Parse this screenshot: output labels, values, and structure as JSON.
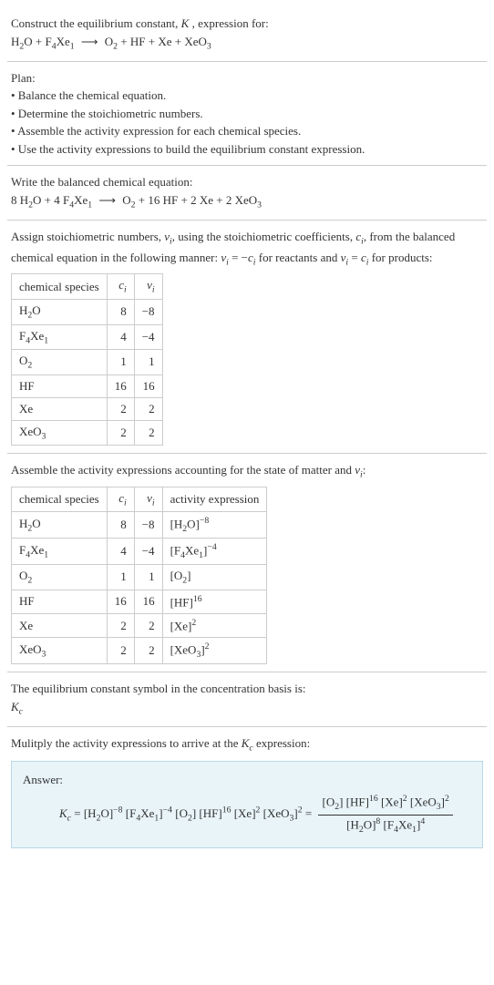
{
  "section1": {
    "l1": "Construct the equilibrium constant, K, expression for:",
    "l2_a": "H",
    "l2_b": "2",
    "l2_c": "O + F",
    "l2_d": "4",
    "l2_e": "Xe",
    "l2_f": "1",
    "l2_arrow": "⟶",
    "l2_g": "O",
    "l2_h": "2",
    "l2_i": " + HF + Xe + XeO",
    "l2_j": "3"
  },
  "section2": {
    "title": "Plan:",
    "b1": "• Balance the chemical equation.",
    "b2": "• Determine the stoichiometric numbers.",
    "b3": "• Assemble the activity expression for each chemical species.",
    "b4": "• Use the activity expressions to build the equilibrium constant expression."
  },
  "section3": {
    "l1": "Write the balanced chemical equation:",
    "l2_a": "8 H",
    "l2_b": "2",
    "l2_c": "O + 4 F",
    "l2_d": "4",
    "l2_e": "Xe",
    "l2_f": "1",
    "l2_arrow": "⟶",
    "l2_g": "O",
    "l2_h": "2",
    "l2_i": " + 16 HF + 2 Xe + 2 XeO",
    "l2_j": "3"
  },
  "section4": {
    "p1_a": "Assign stoichiometric numbers, ",
    "p1_b": "ν",
    "p1_bi": "i",
    "p1_c": ", using the stoichiometric coefficients, ",
    "p1_d": "c",
    "p1_di": "i",
    "p1_e": ", from the balanced chemical equation in the following manner: ",
    "p1_f": "ν",
    "p1_fi": "i",
    "p1_g": " = −",
    "p1_h": "c",
    "p1_hi": "i",
    "p1_j": " for reactants and ",
    "p1_k": "ν",
    "p1_ki": "i",
    "p1_l": " = ",
    "p1_m": "c",
    "p1_mi": "i",
    "p1_n": " for products:",
    "h1": "chemical species",
    "h2": "c",
    "h2i": "i",
    "h3": "ν",
    "h3i": "i",
    "r1c1a": "H",
    "r1c1b": "2",
    "r1c1c": "O",
    "r1c2": "8",
    "r1c3": "−8",
    "r2c1a": "F",
    "r2c1b": "4",
    "r2c1c": "Xe",
    "r2c1d": "1",
    "r2c2": "4",
    "r2c3": "−4",
    "r3c1a": "O",
    "r3c1b": "2",
    "r3c2": "1",
    "r3c3": "1",
    "r4c1": "HF",
    "r4c2": "16",
    "r4c3": "16",
    "r5c1": "Xe",
    "r5c2": "2",
    "r5c3": "2",
    "r6c1a": "XeO",
    "r6c1b": "3",
    "r6c2": "2",
    "r6c3": "2"
  },
  "section5": {
    "p1_a": "Assemble the activity expressions accounting for the state of matter and ",
    "p1_b": "ν",
    "p1_bi": "i",
    "p1_c": ":",
    "h1": "chemical species",
    "h2": "c",
    "h2i": "i",
    "h3": "ν",
    "h3i": "i",
    "h4": "activity expression",
    "r1c1a": "H",
    "r1c1b": "2",
    "r1c1c": "O",
    "r1c2": "8",
    "r1c3": "−8",
    "r1c4a": "[H",
    "r1c4b": "2",
    "r1c4c": "O]",
    "r1c4d": "−8",
    "r2c1a": "F",
    "r2c1b": "4",
    "r2c1c": "Xe",
    "r2c1d": "1",
    "r2c2": "4",
    "r2c3": "−4",
    "r2c4a": "[F",
    "r2c4b": "4",
    "r2c4c": "Xe",
    "r2c4d": "1",
    "r2c4e": "]",
    "r2c4f": "−4",
    "r3c1a": "O",
    "r3c1b": "2",
    "r3c2": "1",
    "r3c3": "1",
    "r3c4a": "[O",
    "r3c4b": "2",
    "r3c4c": "]",
    "r4c1": "HF",
    "r4c2": "16",
    "r4c3": "16",
    "r4c4a": "[HF]",
    "r4c4b": "16",
    "r5c1": "Xe",
    "r5c2": "2",
    "r5c3": "2",
    "r5c4a": "[Xe]",
    "r5c4b": "2",
    "r6c1a": "XeO",
    "r6c1b": "3",
    "r6c2": "2",
    "r6c3": "2",
    "r6c4a": "[XeO",
    "r6c4b": "3",
    "r6c4c": "]",
    "r6c4d": "2"
  },
  "section6": {
    "l1": "The equilibrium constant symbol in the concentration basis is:",
    "l2a": "K",
    "l2b": "c"
  },
  "section7": {
    "l1_a": "Mulitply the activity expressions to arrive at the ",
    "l1_b": "K",
    "l1_bi": "c",
    "l1_c": " expression:",
    "answer_label": "Answer:",
    "lhs_a": "K",
    "lhs_b": "c",
    "lhs_eq": " = ",
    "t1a": "[H",
    "t1b": "2",
    "t1c": "O]",
    "t1d": "−8",
    "t2a": " [F",
    "t2b": "4",
    "t2c": "Xe",
    "t2d": "1",
    "t2e": "]",
    "t2f": "−4",
    "t3a": " [O",
    "t3b": "2",
    "t3c": "]",
    "t4a": " [HF]",
    "t4b": "16",
    "t5a": " [Xe]",
    "t5b": "2",
    "t6a": " [XeO",
    "t6b": "3",
    "t6c": "]",
    "t6d": "2",
    "teq": " = ",
    "num1a": "[O",
    "num1b": "2",
    "num1c": "]",
    "num2a": " [HF]",
    "num2b": "16",
    "num3a": " [Xe]",
    "num3b": "2",
    "num4a": " [XeO",
    "num4b": "3",
    "num4c": "]",
    "num4d": "2",
    "den1a": "[H",
    "den1b": "2",
    "den1c": "O]",
    "den1d": "8",
    "den2a": " [F",
    "den2b": "4",
    "den2c": "Xe",
    "den2d": "1",
    "den2e": "]",
    "den2f": "4"
  }
}
